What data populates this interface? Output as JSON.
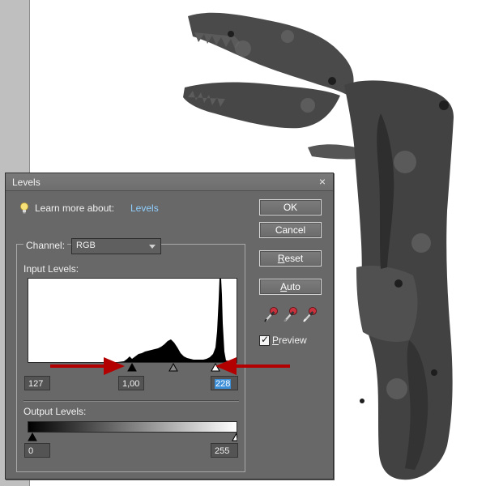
{
  "dialog": {
    "title": "Levels",
    "close_glyph": "×",
    "learn_more_text": "Learn more about:",
    "learn_more_link": "Levels",
    "icon": "lightbulb-icon"
  },
  "buttons": {
    "ok": "OK",
    "cancel": "Cancel",
    "reset_mnemonic": "R",
    "reset_rest": "eset",
    "auto_mnemonic": "A",
    "auto_rest": "uto"
  },
  "eyedroppers": [
    "black-point-eyedropper-icon",
    "gray-point-eyedropper-icon",
    "white-point-eyedropper-icon"
  ],
  "preview": {
    "checked": true,
    "mnemonic": "P",
    "rest": "review"
  },
  "channel": {
    "label": "Channel:",
    "selected": "RGB"
  },
  "input_levels": {
    "label": "Input Levels:",
    "black": "127",
    "gamma": "1,00",
    "white": "228",
    "black_value": 127,
    "white_value": 228
  },
  "output_levels": {
    "label": "Output Levels:",
    "black": "0",
    "white": "255",
    "black_value": 0,
    "white_value": 255
  },
  "colors": {
    "dialog_bg": "#686868",
    "link": "#8fcfff",
    "annotation_arrow": "#b30000",
    "selection": "#3d8fd8"
  }
}
